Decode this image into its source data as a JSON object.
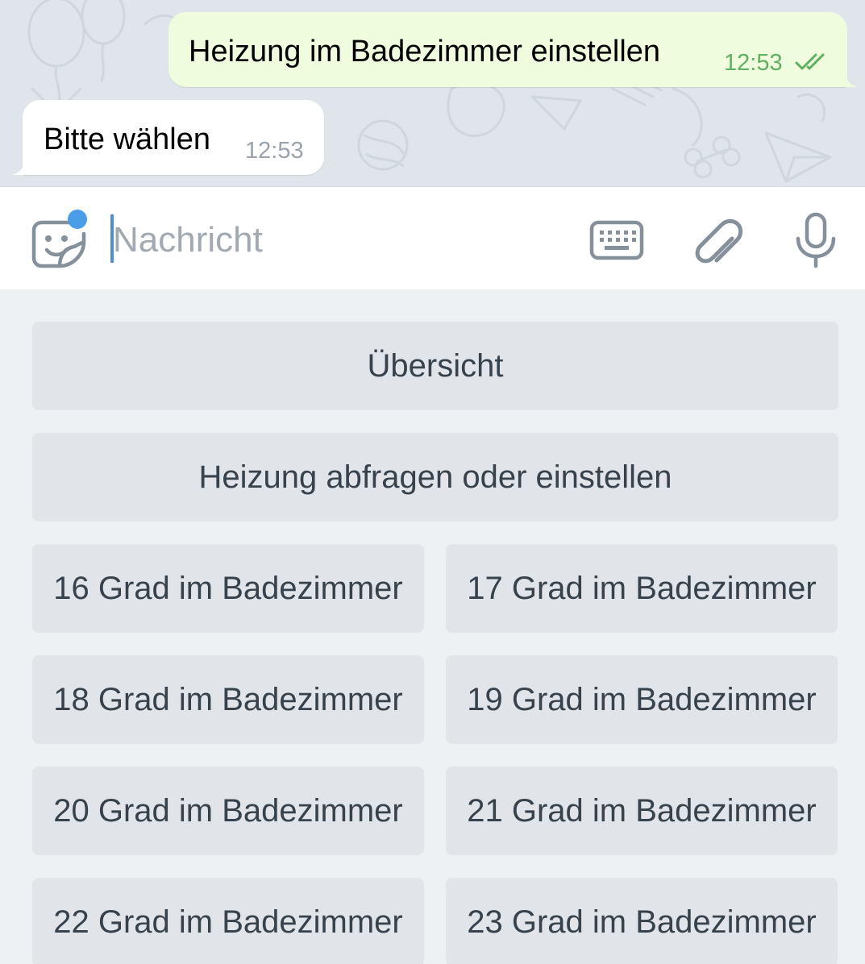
{
  "chat": {
    "outgoing": {
      "text": "Heizung im Badezimmer einstellen",
      "time": "12:53",
      "status_icon": "double-check-icon"
    },
    "incoming": {
      "text": "Bitte wählen",
      "time": "12:53"
    }
  },
  "input_bar": {
    "placeholder": "Nachricht",
    "value": "",
    "icons": [
      "sticker-emoji-icon",
      "keyboard-icon",
      "paperclip-icon",
      "microphone-icon"
    ],
    "accent_color": "#4c8fd6"
  },
  "bot_keyboard": {
    "rows": [
      [
        "Übersicht"
      ],
      [
        "Heizung abfragen oder einstellen"
      ],
      [
        "16 Grad im Badezimmer",
        "17 Grad im Badezimmer"
      ],
      [
        "18 Grad im Badezimmer",
        "19 Grad im Badezimmer"
      ],
      [
        "20 Grad im Badezimmer",
        "21 Grad im Badezimmer"
      ],
      [
        "22 Grad im Badezimmer",
        "23 Grad im Badezimmer"
      ]
    ]
  },
  "colors": {
    "outgoing_bubble": "#effdde",
    "incoming_bubble": "#ffffff",
    "outgoing_time": "#5fb060",
    "keyboard_button": "#e1e5e9",
    "keyboard_text": "#37424c"
  }
}
